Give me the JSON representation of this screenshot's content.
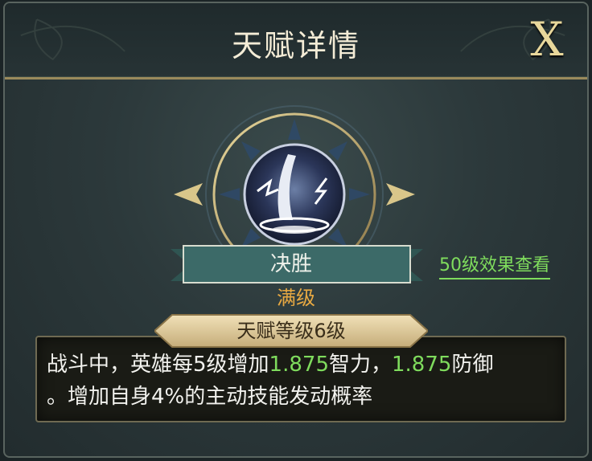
{
  "dialog": {
    "title": "天赋详情",
    "close_label": "X"
  },
  "talent": {
    "icon": "lightning-slash-icon",
    "name": "决胜",
    "status": "满级",
    "grade_label": "天赋等级6级",
    "level50_link": "50级效果查看",
    "description": {
      "line1_a": "战斗中，英雄每5级增加",
      "value1": "1.875",
      "line1_b": "智力，",
      "value2": "1.875",
      "line1_c": "防御",
      "line2": "。增加自身4%的主动技能发动概率"
    }
  },
  "colors": {
    "title_text": "#f4ecd6",
    "close_gold": "#e8d79b",
    "status_orange": "#e8a942",
    "highlight_green": "#7fdc5d",
    "banner_teal": "#3c6a68"
  }
}
